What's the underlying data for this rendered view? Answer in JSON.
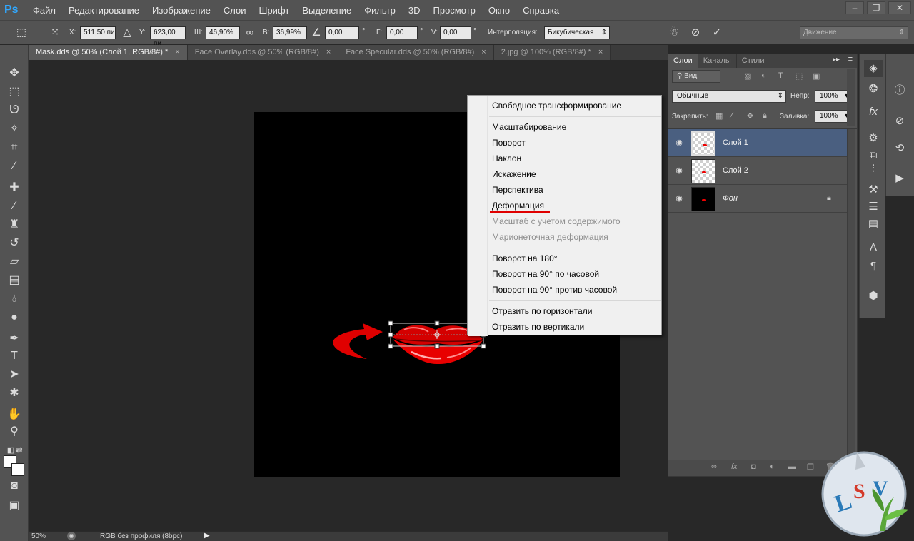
{
  "app": {
    "logo": "Ps",
    "menu": [
      "Файл",
      "Редактирование",
      "Изображение",
      "Слои",
      "Шрифт",
      "Выделение",
      "Фильтр",
      "3D",
      "Просмотр",
      "Окно",
      "Справка"
    ],
    "window_buttons": [
      "–",
      "❐",
      "✕"
    ]
  },
  "options": {
    "x_label": "X:",
    "x_value": "511,50 пи",
    "y_label": "Y:",
    "y_value": "623,00 пи",
    "w_label": "Ш:",
    "w_value": "46,90%",
    "h_label": "В:",
    "h_value": "36,99%",
    "angle_value": "0,00",
    "angle_unit": "°",
    "hskew_label": "Г:",
    "hskew_value": "0,00",
    "hskew_unit": "°",
    "vskew_label": "V:",
    "vskew_value": "0,00",
    "vskew_unit": "°",
    "interp_label": "Интерполяция:",
    "interp_value": "Бикубическая",
    "workspace_value": "Движение"
  },
  "tabs": [
    {
      "label": "Mask.dds @ 50% (Слой 1, RGB/8#) *",
      "close": "×",
      "active": true
    },
    {
      "label": "Face Overlay.dds @ 50% (RGB/8#)",
      "close": "×",
      "active": false
    },
    {
      "label": "Face Specular.dds @ 50% (RGB/8#)",
      "close": "×",
      "active": false
    },
    {
      "label": "2.jpg @ 100% (RGB/8#) *",
      "close": "×",
      "active": false
    }
  ],
  "context_menu": {
    "items": [
      {
        "label": "Свободное трансформирование",
        "disabled": false
      },
      {
        "label": "Масштабирование",
        "disabled": false
      },
      {
        "label": "Поворот",
        "disabled": false
      },
      {
        "label": "Наклон",
        "disabled": false
      },
      {
        "label": "Искажение",
        "disabled": false
      },
      {
        "label": "Перспектива",
        "disabled": false
      },
      {
        "label": "Деформация",
        "disabled": false
      },
      {
        "label": "Масштаб с учетом содержимого",
        "disabled": true
      },
      {
        "label": "Марионеточная деформация",
        "disabled": true
      },
      {
        "label": "Поворот на 180°",
        "disabled": false
      },
      {
        "label": "Поворот на 90° по часовой",
        "disabled": false
      },
      {
        "label": "Поворот на 90° против часовой",
        "disabled": false
      },
      {
        "label": "Отразить по горизонтали",
        "disabled": false
      },
      {
        "label": "Отразить по вертикали",
        "disabled": false
      }
    ],
    "highlight_color": "#e00000"
  },
  "layers_panel": {
    "tabs": [
      "Слои",
      "Каналы",
      "Стили"
    ],
    "filter_kind": "Вид",
    "blend_mode": "Обычные",
    "opacity_label": "Непр:",
    "opacity_value": "100%",
    "lock_label": "Закрепить:",
    "fill_label": "Заливка:",
    "fill_value": "100%",
    "layers": [
      {
        "name": "Слой 1",
        "selected": true
      },
      {
        "name": "Слой 2",
        "selected": false
      },
      {
        "name": "Фон",
        "selected": false,
        "locked": true
      }
    ]
  },
  "status": {
    "zoom": "50%",
    "profile": "RGB без профиля (8bpc)"
  },
  "watermark_text": "LSV",
  "colors": {
    "accent_red": "#e00000",
    "selected_layer": "#4a5f80",
    "ps_blue": "#31a8ff"
  }
}
